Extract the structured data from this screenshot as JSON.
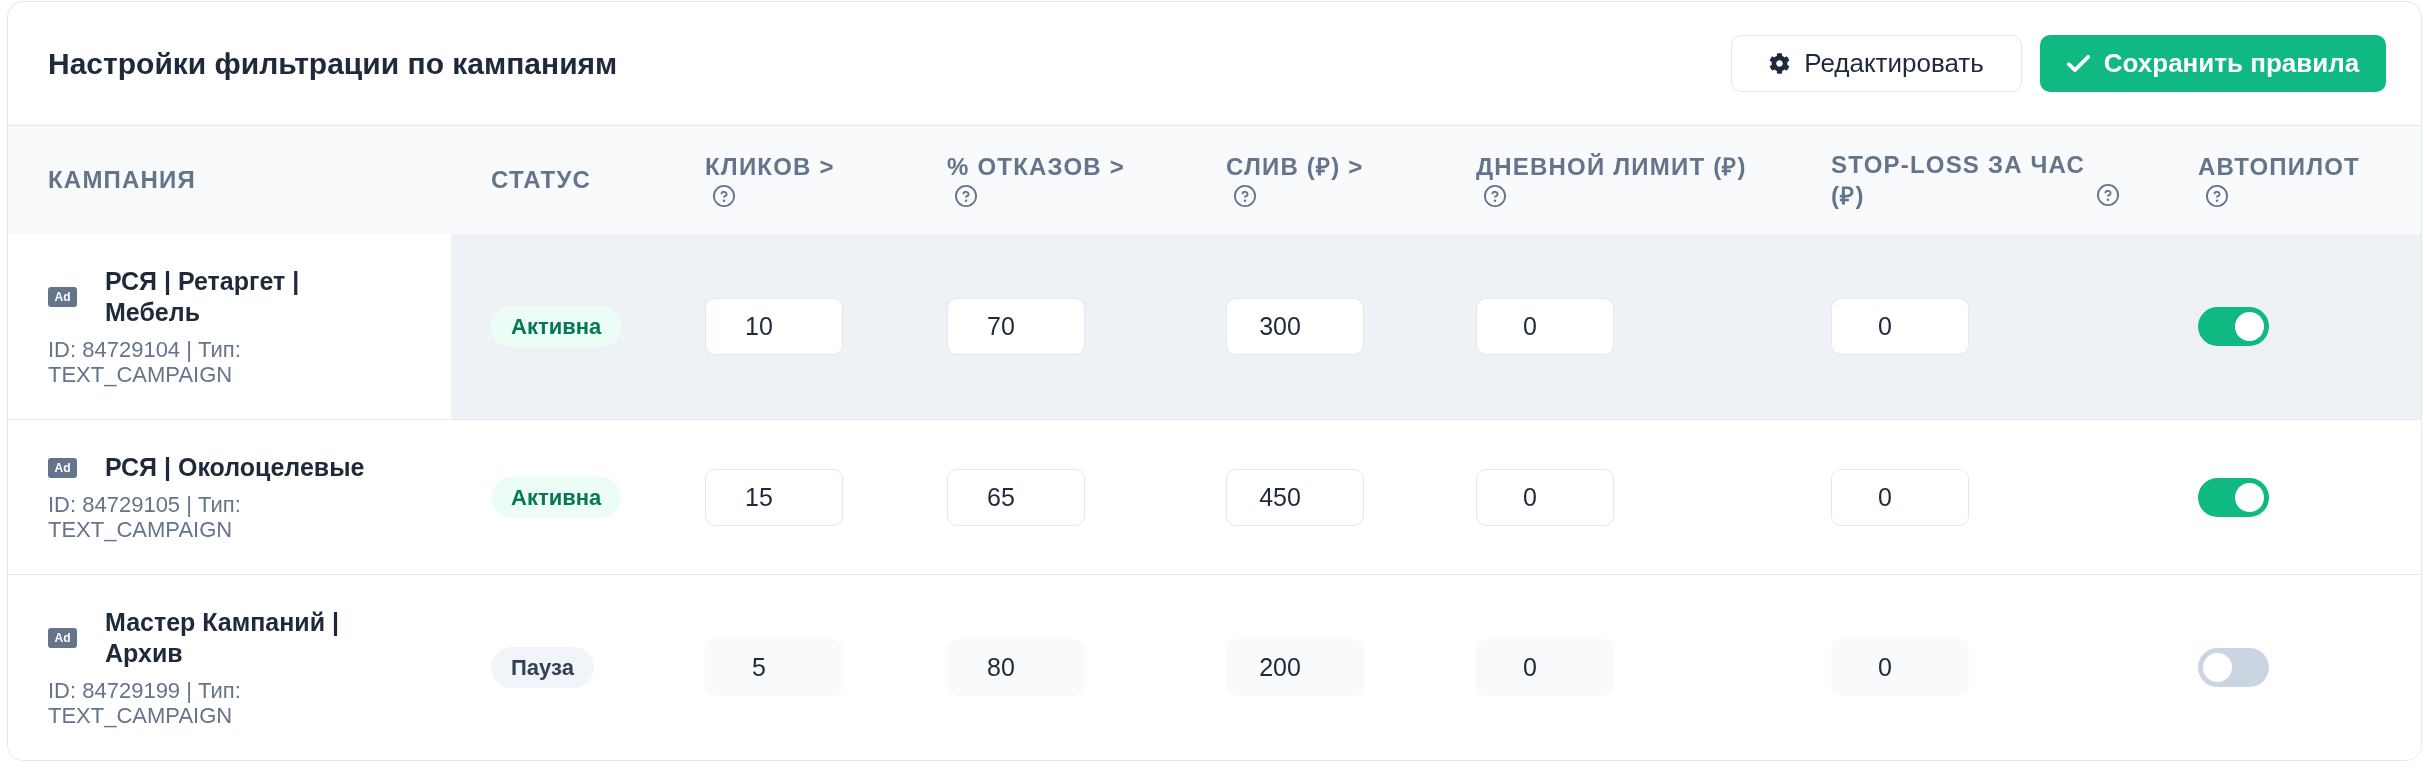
{
  "header": {
    "title": "Настройки фильтрации по кампаниям",
    "buttons": [
      {
        "kind": "secondary",
        "label": "Редактировать"
      },
      {
        "kind": "primary",
        "label": "Сохранить правила"
      }
    ]
  },
  "table": {
    "columns": [
      {
        "label": "КАМПАНИЯ",
        "help": false
      },
      {
        "label": "СТАТУС",
        "help": false
      },
      {
        "label": "КЛИКОВ >",
        "help": true
      },
      {
        "label": "% ОТКАЗОВ >",
        "help": true
      },
      {
        "label": "СЛИВ (₽) >",
        "help": true
      },
      {
        "label": "ДНЕВНОЙ ЛИМИТ (₽)",
        "help": true
      },
      {
        "label": "STOP-LOSS ЗА ЧАС (₽)",
        "help": true
      },
      {
        "label": "АВТОПИЛОТ",
        "help": true
      }
    ],
    "rows": [
      {
        "highlighted": true,
        "tag": "Ad",
        "name": "РСЯ | Ретаргет | Мебель",
        "meta": "ID: 84729104 | Тип: TEXT_CAMPAIGN",
        "status": {
          "kind": "active",
          "label": "Активна"
        },
        "disabled": false,
        "values": [
          "10",
          "70",
          "300",
          "0",
          "0"
        ],
        "autopilot_on": true
      },
      {
        "highlighted": false,
        "tag": "Ad",
        "name": "РСЯ | Околоцелевые",
        "meta": "ID: 84729105 | Тип: TEXT_CAMPAIGN",
        "status": {
          "kind": "active",
          "label": "Активна"
        },
        "disabled": false,
        "values": [
          "15",
          "65",
          "450",
          "0",
          "0"
        ],
        "autopilot_on": true
      },
      {
        "highlighted": false,
        "tag": "Ad",
        "name": "Мастер Кампаний | Архив",
        "meta": "ID: 84729199 | Тип: TEXT_CAMPAIGN",
        "status": {
          "kind": "paused",
          "label": "Пауза"
        },
        "disabled": true,
        "values": [
          "5",
          "80",
          "200",
          "0",
          "0"
        ],
        "autopilot_on": false
      }
    ]
  }
}
